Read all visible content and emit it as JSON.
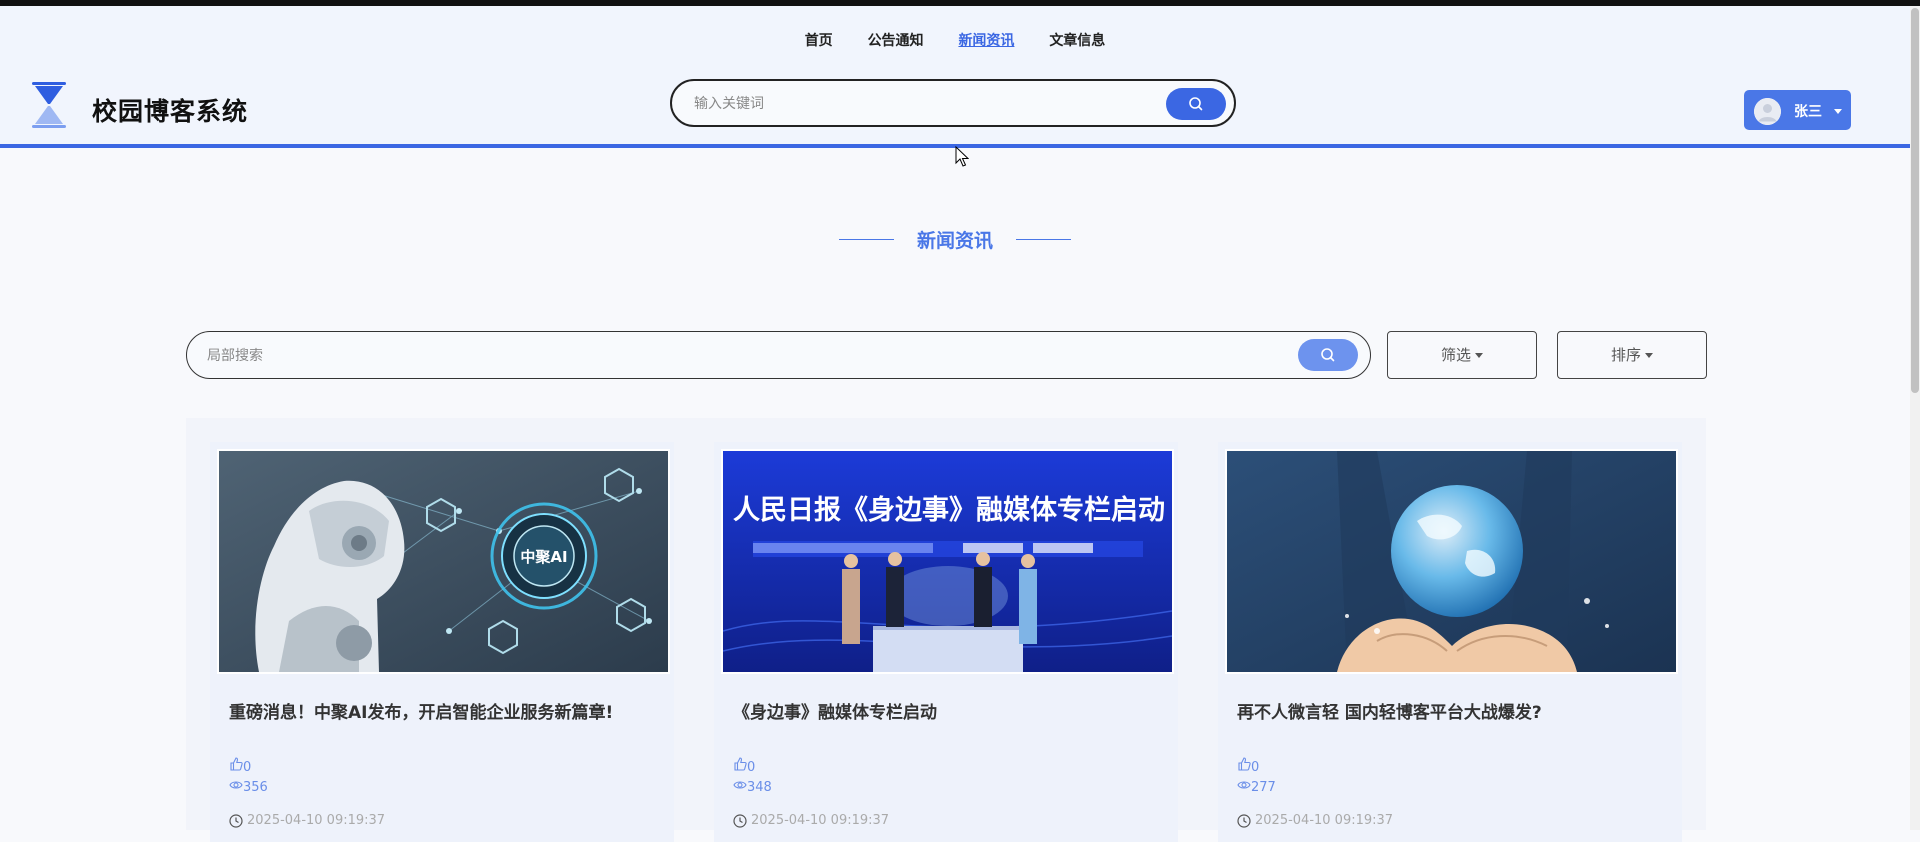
{
  "app": {
    "site_title": "校园博客系统"
  },
  "nav": {
    "items": [
      {
        "label": "首页"
      },
      {
        "label": "公告通知"
      },
      {
        "label": "新闻资讯",
        "active": true
      },
      {
        "label": "文章信息"
      }
    ]
  },
  "header_search": {
    "placeholder": "输入关键词",
    "value": "",
    "icon": "search-icon"
  },
  "user": {
    "name": "张三",
    "icon": "chevron-down-icon"
  },
  "section": {
    "title": "新闻资讯"
  },
  "local_search": {
    "placeholder": "局部搜索",
    "value": "",
    "icon": "search-icon"
  },
  "toolbar": {
    "filter_label": "筛选",
    "sort_label": "排序"
  },
  "news": [
    {
      "title": "重磅消息！中聚AI发布，开启智能企业服务新篇章!",
      "image_text": "中聚AI",
      "likes": "0",
      "views": "356",
      "time": "2025-04-10 09:19:37"
    },
    {
      "title": "《身边事》融媒体专栏启动",
      "image_text": "人民日报《身边事》融媒体专栏启动",
      "likes": "0",
      "views": "348",
      "time": "2025-04-10 09:19:37"
    },
    {
      "title": "再不人微言轻 国内轻博客平台大战爆发?",
      "image_text": "",
      "likes": "0",
      "views": "277",
      "time": "2025-04-10 09:19:37"
    }
  ],
  "colors": {
    "accent": "#3b67e3",
    "accent_light": "#6d93ee",
    "header_bg": "#f1f5fd",
    "page_bg": "#f8f9fc"
  }
}
